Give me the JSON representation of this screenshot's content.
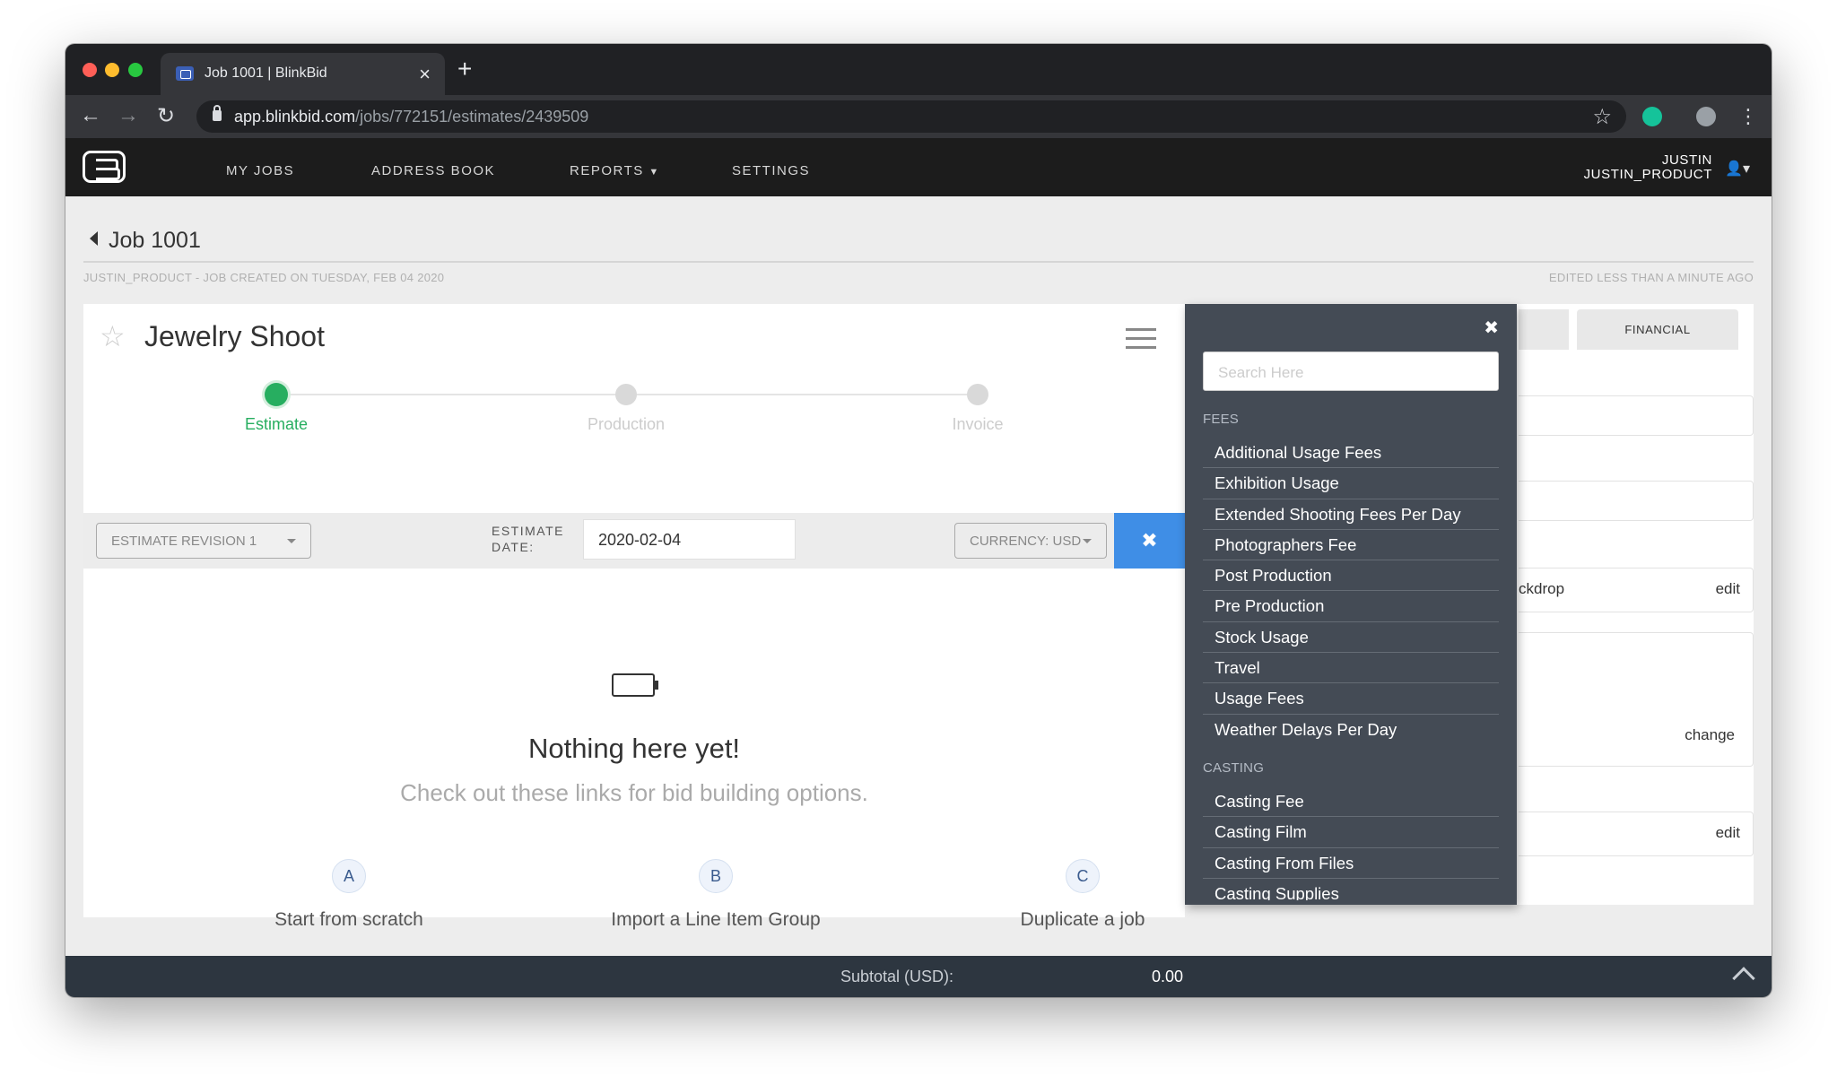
{
  "browser": {
    "tab_title": "Job 1001 | BlinkBid",
    "url_host": "app.blinkbid.com",
    "url_path": "/jobs/772151/estimates/2439509"
  },
  "nav": {
    "items": [
      "MY JOBS",
      "ADDRESS BOOK",
      "REPORTS",
      "SETTINGS"
    ],
    "user_name": "JUSTIN",
    "user_account": "JUSTIN_PRODUCT"
  },
  "page": {
    "back_label": "Job 1001",
    "created_meta": "JUSTIN_PRODUCT - JOB CREATED ON TUESDAY, FEB 04 2020",
    "edited_meta": "EDITED LESS THAN A MINUTE AGO"
  },
  "job": {
    "title": "Jewelry Shoot",
    "steps": [
      {
        "label": "Estimate",
        "active": true
      },
      {
        "label": "Production",
        "active": false
      },
      {
        "label": "Invoice",
        "active": false
      }
    ],
    "revision": "ESTIMATE REVISION 1",
    "estimate_date_label_1": "ESTIMATE",
    "estimate_date_label_2": "DATE:",
    "estimate_date": "2020-02-04",
    "currency": "CURRENCY: USD",
    "empty_title": "Nothing here yet!",
    "empty_subtitle": "Check out these links for bid building options.",
    "options": [
      {
        "letter": "A",
        "label": "Start from scratch"
      },
      {
        "letter": "B",
        "label": "Import a Line Item Group"
      },
      {
        "letter": "C",
        "label": "Duplicate a job"
      }
    ]
  },
  "right_panel": {
    "tab_financial": "FINANCIAL",
    "backdrop_fragment": "ckdrop",
    "edit_label": "edit",
    "change_label": "change"
  },
  "dropdown": {
    "search_placeholder": "Search Here",
    "sections": [
      {
        "heading": "FEES",
        "items": [
          "Additional Usage Fees",
          "Exhibition Usage",
          "Extended Shooting Fees Per Day",
          "Photographers Fee",
          "Post Production",
          "Pre Production",
          "Stock Usage",
          "Travel",
          "Usage Fees",
          "Weather Delays Per Day"
        ]
      },
      {
        "heading": "CASTING",
        "items": [
          "Casting Fee",
          "Casting Film",
          "Casting From Files",
          "Casting Supplies"
        ]
      }
    ]
  },
  "footer": {
    "subtotal_label": "Subtotal (USD):",
    "subtotal_value": "0.00"
  },
  "colors": {
    "accent_green": "#27ae60",
    "accent_blue": "#3f8ee6",
    "dropdown_bg": "#444b55",
    "footer_bg": "#2d3640"
  }
}
